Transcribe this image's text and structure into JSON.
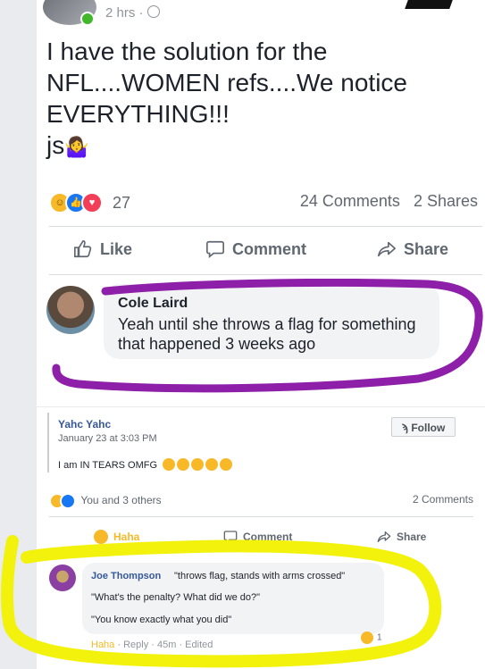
{
  "post": {
    "time": "2 hrs ·",
    "lines": [
      "I have the solution for the",
      "NFL....WOMEN refs....We notice",
      "EVERYTHING!!!",
      "js"
    ],
    "emoji": "🤷‍♀️",
    "reaction_count": "27",
    "comments_count": "24 Comments",
    "shares_count": "2 Shares",
    "actions": {
      "like": "Like",
      "comment": "Comment",
      "share": "Share"
    }
  },
  "comment": {
    "author": "Cole Laird",
    "text": "Yeah until she throws a flag for something that happened 3 weeks ago"
  },
  "shared_post": {
    "author": "Yahc Yahc",
    "date": "January 23 at 3:03 PM",
    "follow_label": "Follow",
    "follow_icon": "rss-icon",
    "text": "I am IN TEARS OMFG",
    "reactions_text": "You and 3 others",
    "comments_count": "2 Comments",
    "actions": {
      "haha": "Haha",
      "comment": "Comment",
      "share": "Share"
    }
  },
  "reply": {
    "author": "Joe Thompson",
    "line1": "\"throws flag, stands with arms crossed\"",
    "line2": "\"What's the penalty? What did we do?\"",
    "line3": "\"You know exactly what you did\"",
    "haha": "Haha",
    "reply_label": "Reply",
    "time": "45m",
    "edited": "Edited",
    "reaction_count": "1"
  },
  "colors": {
    "facebook_blue": "#1877f2",
    "link_blue": "#365899",
    "haha_yellow": "#f7b928",
    "purple_marker": "#8e1fa8",
    "yellow_marker": "#f2f20c"
  }
}
